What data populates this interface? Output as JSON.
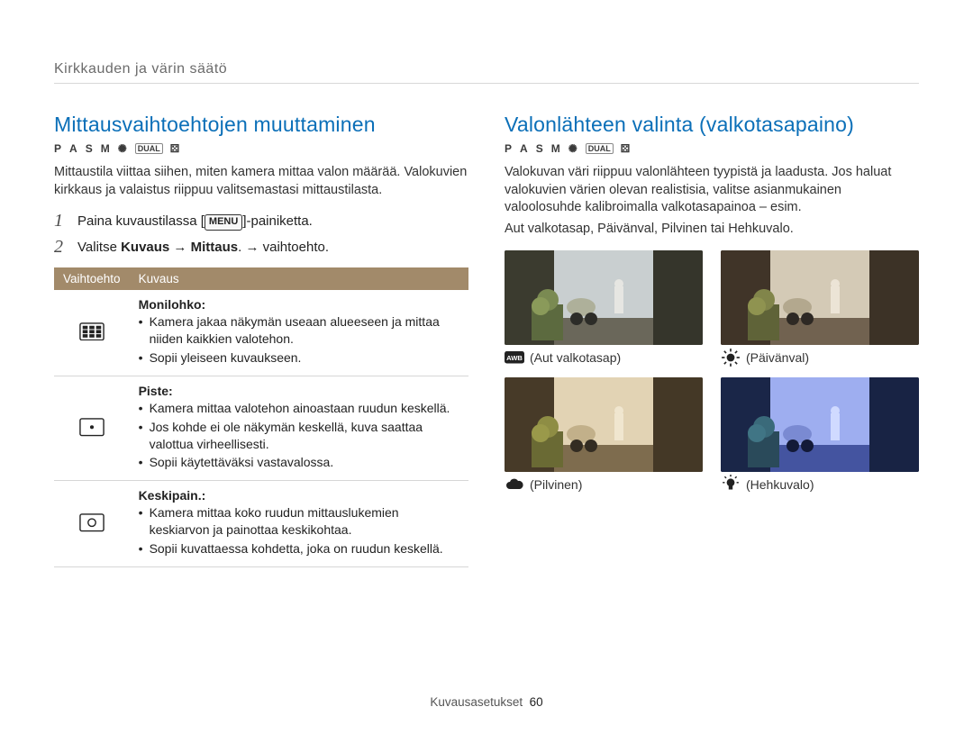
{
  "breadcrumb": "Kirkkauden ja värin säätö",
  "left": {
    "heading": "Mittausvaihtoehtojen muuttaminen",
    "modes": [
      "P",
      "A",
      "S",
      "M"
    ],
    "modes_extra1": "DUAL",
    "intro": "Mittaustila viittaa siihen, miten kamera mittaa valon määrää. Valokuvien kirkkaus ja valaistus riippuu valitsemastasi mittaustilasta.",
    "step1_pre": "Paina kuvaustilassa [",
    "step1_btn": "MENU",
    "step1_post": "]-painiketta.",
    "step2_pre": "Valitse ",
    "step2_b1": "Kuvaus",
    "step2_arrow1": " → ",
    "step2_b2": "Mittaus",
    "step2_post": ". → vaihtoehto.",
    "table": {
      "th1": "Vaihtoehto",
      "th2": "Kuvaus",
      "rows": [
        {
          "icon": "multi",
          "title": "Monilohko:",
          "items": [
            "Kamera jakaa näkymän useaan alueeseen ja mittaa niiden kaikkien valotehon.",
            "Sopii yleiseen kuvaukseen."
          ]
        },
        {
          "icon": "spot",
          "title": "Piste:",
          "items": [
            "Kamera mittaa valotehon ainoastaan ruudun keskellä.",
            "Jos kohde ei ole näkymän keskellä, kuva saattaa valottua virheellisesti.",
            "Sopii käytettäväksi vastavalossa."
          ]
        },
        {
          "icon": "center",
          "title": "Keskipain.:",
          "items": [
            "Kamera mittaa koko ruudun mittauslukemien keskiarvon ja painottaa keskikohtaa.",
            "Sopii kuvattaessa kohdetta, joka on ruudun keskellä."
          ]
        }
      ]
    }
  },
  "right": {
    "heading": "Valonlähteen valinta (valkotasapaino)",
    "modes": [
      "P",
      "A",
      "S",
      "M"
    ],
    "modes_extra1": "DUAL",
    "intro": "Valokuvan väri riippuu valonlähteen tyypistä ja laadusta. Jos haluat valokuvien värien olevan realistisia, valitse asianmukainen valoolosuhde kalibroimalla valkotasapainoa – esim.",
    "intro2": "Aut valkotasap, Päivänval, Pilvinen tai Hehkuvalo.",
    "thumbs": [
      {
        "label": "(Aut valkotasap)",
        "icon": "awb",
        "tint": "normal"
      },
      {
        "label": "(Päivänval)",
        "icon": "sun",
        "tint": "warm"
      },
      {
        "label": "(Pilvinen)",
        "icon": "cloud",
        "tint": "cool"
      },
      {
        "label": "(Hehkuvalo)",
        "icon": "bulb",
        "tint": "blue"
      }
    ]
  },
  "footer": {
    "section": "Kuvausasetukset",
    "page": "60"
  }
}
